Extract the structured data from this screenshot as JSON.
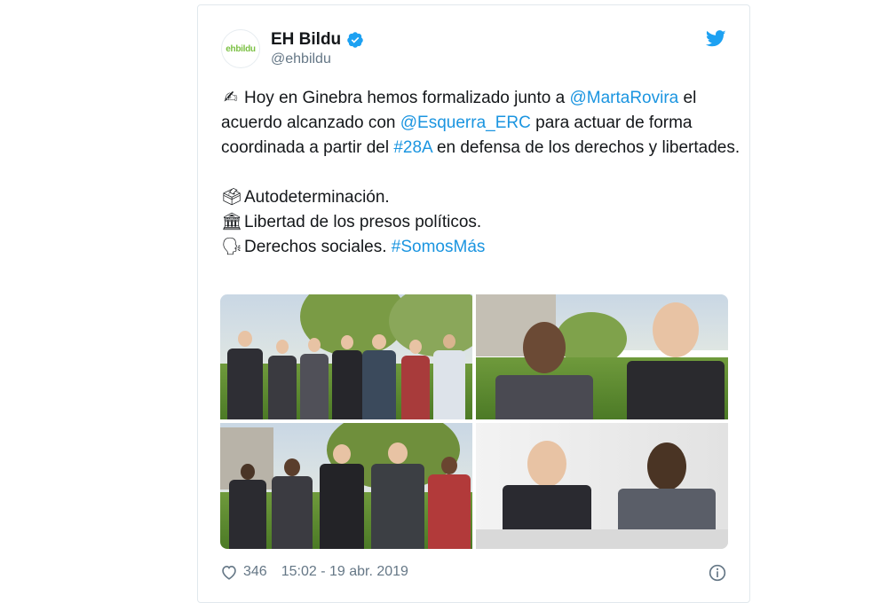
{
  "tweet": {
    "avatar_text": "ehbildu",
    "display_name": "EH Bildu",
    "handle": "@ehbildu",
    "lines": {
      "l1_emoji": "✍",
      "l1_a": "Hoy en Ginebra hemos formalizado junto a ",
      "l1_mention": "@MartaRovira",
      "l1_b": " el acuerdo alcanzado con ",
      "l1_mention2": "@Esquerra_ERC",
      "l1_c": " para actuar de forma coordinada a partir del ",
      "l1_hashtag": "#28A",
      "l1_d": " en defensa de los derechos y libertades.",
      "l2_emoji": "🗳",
      "l2_text": "Autodeterminación.",
      "l3_emoji": "🏛",
      "l3_text": "Libertad de los presos políticos.",
      "l4_emoji": "🗣",
      "l4_text": "Derechos sociales. ",
      "l4_hashtag": "#SomosMás"
    },
    "likes": "346",
    "timestamp": "15:02 - 19 abr. 2019"
  },
  "colors": {
    "link": "#1b95e0",
    "verified": "#1da1f2",
    "twitter_blue": "#1da1f2",
    "muted": "#657786"
  },
  "icons": {
    "verified": "verified-badge-icon",
    "logo": "twitter-bird-icon",
    "like": "heart-icon",
    "info": "info-icon"
  }
}
